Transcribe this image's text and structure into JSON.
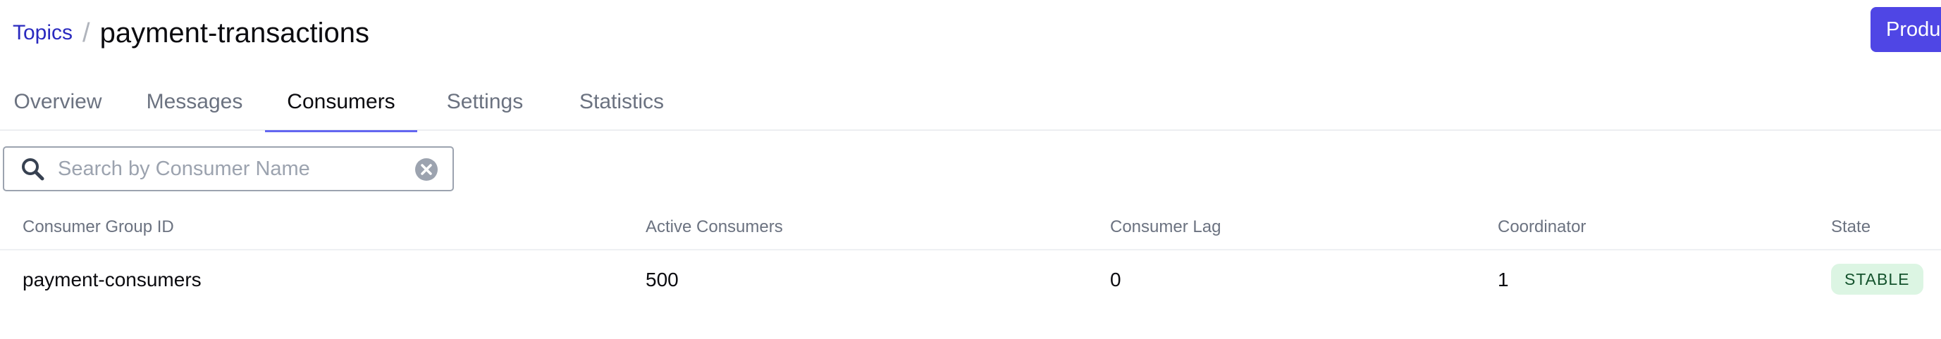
{
  "breadcrumb": {
    "parent": "Topics",
    "separator": "/",
    "title": "payment-transactions"
  },
  "header": {
    "produce_button_label": "Produce"
  },
  "tabs": [
    {
      "label": "Overview",
      "active": false
    },
    {
      "label": "Messages",
      "active": false
    },
    {
      "label": "Consumers",
      "active": true
    },
    {
      "label": "Settings",
      "active": false
    },
    {
      "label": "Statistics",
      "active": false
    }
  ],
  "search": {
    "placeholder": "Search by Consumer Name",
    "value": ""
  },
  "table": {
    "columns": [
      "Consumer Group ID",
      "Active Consumers",
      "Consumer Lag",
      "Coordinator",
      "State"
    ],
    "rows": [
      {
        "group_id": "payment-consumers",
        "active_consumers": "500",
        "consumer_lag": "0",
        "coordinator": "1",
        "state": "STABLE"
      }
    ]
  },
  "colors": {
    "accent": "#4f46e5",
    "tab_underline": "#6366f1",
    "link": "#2a2abf",
    "state_stable_bg": "#dcf5e3"
  },
  "icons": {
    "search": "search-icon",
    "clear": "clear-circle-icon"
  }
}
